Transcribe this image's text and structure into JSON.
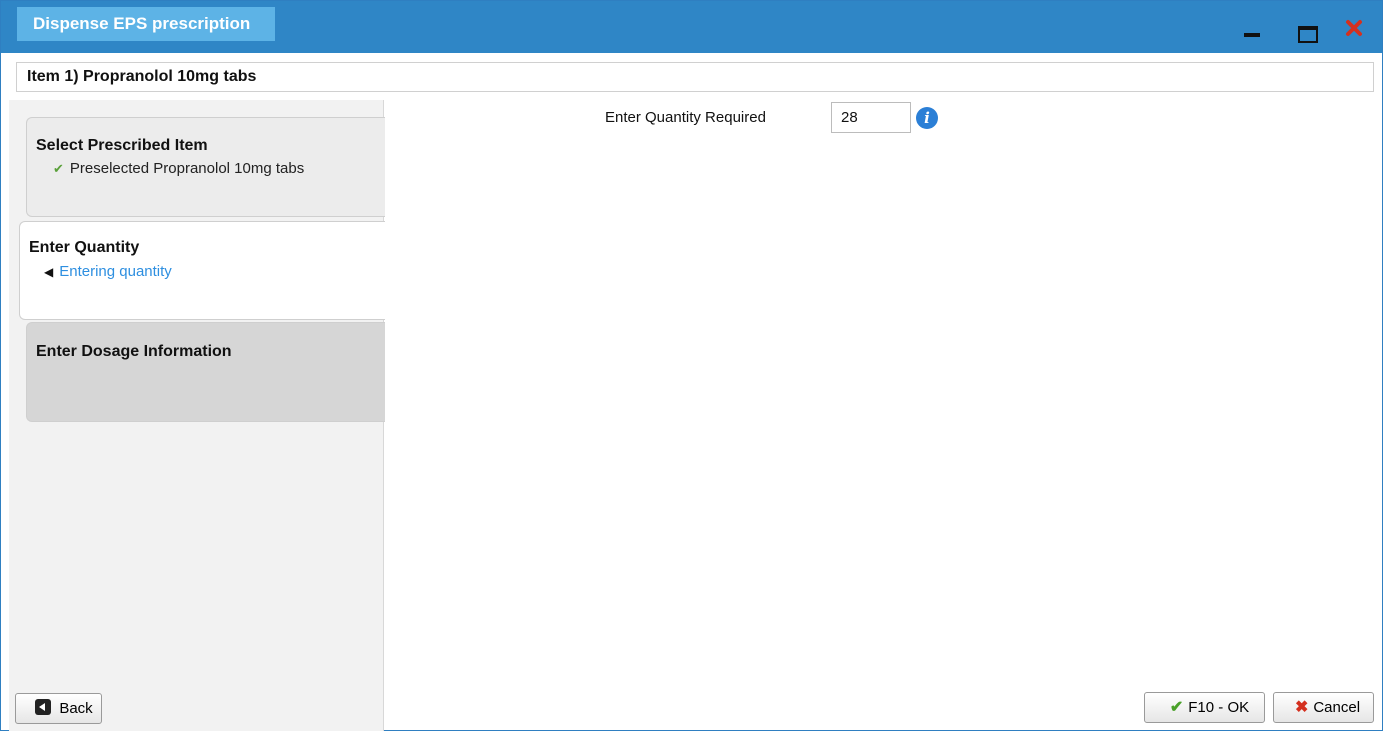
{
  "window": {
    "title": "Dispense EPS prescription",
    "controls": [
      "minimize",
      "maximize",
      "close"
    ]
  },
  "item_header": "Item 1) Propranolol 10mg tabs",
  "steps": [
    {
      "title": "Select Prescribed Item",
      "subtitle": "Preselected Propranolol 10mg tabs",
      "icon": "check-icon",
      "state": "done"
    },
    {
      "title": "Enter Quantity",
      "subtitle": "Entering quantity",
      "icon": "arrow-left-icon",
      "state": "current"
    },
    {
      "title": "Enter Dosage Information",
      "subtitle": "",
      "state": "pending"
    }
  ],
  "quantity": {
    "label": "Enter Quantity Required",
    "value": "28",
    "info_icon": "info-icon"
  },
  "buttons": {
    "back": "Back",
    "ok": "F10 - OK",
    "cancel": "Cancel"
  },
  "colors": {
    "titlebar": "#2f86c6",
    "title_tab": "#5db3e6",
    "active_sub": "#2e8fe0",
    "check": "#5aa03a",
    "close_x": "#d4301f"
  }
}
